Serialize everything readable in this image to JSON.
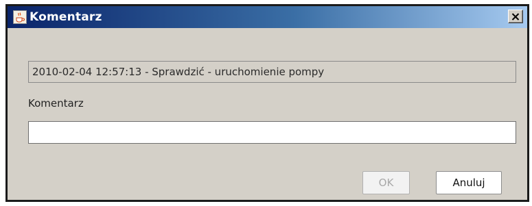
{
  "window": {
    "title": "Komentarz",
    "icon": "java-coffee-cup-icon",
    "close_icon": "close-x-icon"
  },
  "dialog": {
    "event_text": "2010-02-04 12:57:13 - Sprawdzić - uruchomienie pompy",
    "comment_label": "Komentarz",
    "comment_value": "",
    "comment_placeholder": ""
  },
  "buttons": {
    "ok_label": "OK",
    "ok_enabled": false,
    "cancel_label": "Anuluj"
  },
  "colors": {
    "titlebar_start": "#0a246a",
    "titlebar_end": "#a6caf0",
    "window_background": "#d4d0c8"
  }
}
